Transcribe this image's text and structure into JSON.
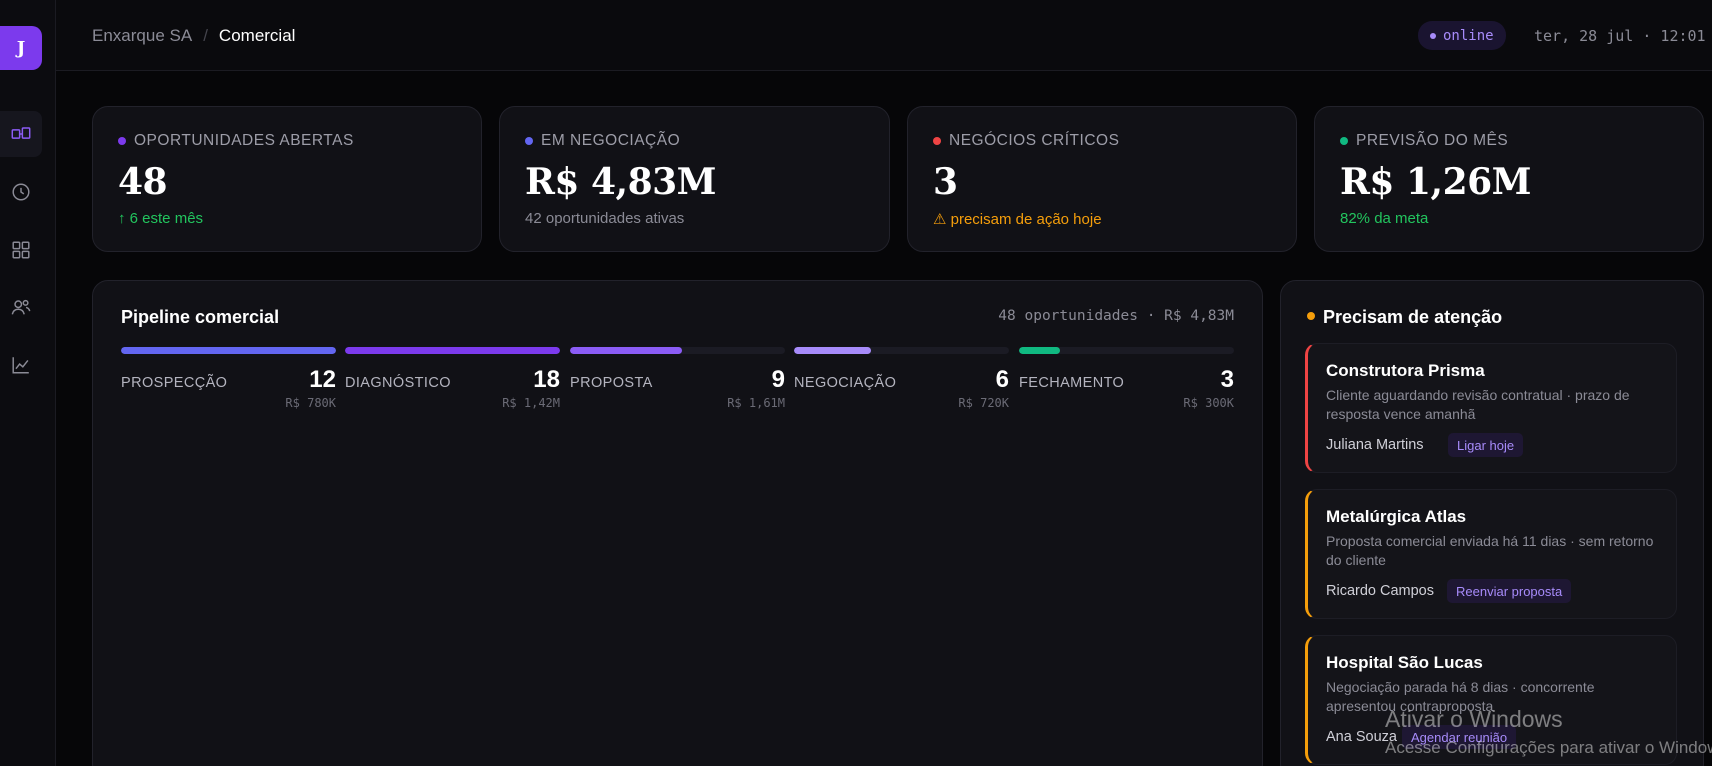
{
  "sidebar": {
    "avatar_initial": "J",
    "items": [
      {
        "icon": "pipeline-icon",
        "active": true
      },
      {
        "icon": "clock-icon",
        "active": false
      },
      {
        "icon": "grid-icon",
        "active": false
      },
      {
        "icon": "users-icon",
        "active": false
      },
      {
        "icon": "chart-icon",
        "active": false
      }
    ]
  },
  "header": {
    "breadcrumb": {
      "org": "Enxarque SA",
      "separator": "/",
      "current": "Comercial"
    },
    "status": "online",
    "datetime": "ter, 28 jul · 12:01"
  },
  "kpis": [
    {
      "label": "OPORTUNIDADES ABERTAS",
      "value": "48",
      "sub": "↑ 6 este mês",
      "dot_color": "#7c3aed",
      "sub_color": "#22c55e"
    },
    {
      "label": "EM NEGOCIAÇÃO",
      "value": "R$ 4,83M",
      "sub": "42 oportunidades ativas",
      "dot_color": "#6366f1",
      "sub_color": "#8b8b96"
    },
    {
      "label": "NEGÓCIOS CRÍTICOS",
      "value": "3",
      "sub": "⚠ precisam de ação hoje",
      "dot_color": "#ef4444",
      "sub_color": "#f59e0b"
    },
    {
      "label": "PREVISÃO DO MÊS",
      "value": "R$ 1,26M",
      "sub": "82% da meta",
      "dot_color": "#10b981",
      "sub_color": "#22c55e"
    }
  ],
  "pipeline": {
    "title": "Pipeline comercial",
    "meta": "48 oportunidades · R$ 4,83M",
    "stages": [
      {
        "name": "PROSPECÇÃO",
        "count": "12",
        "value": "R$ 780K",
        "progress": 1.0,
        "color": "#6366f1"
      },
      {
        "name": "DIAGNÓSTICO",
        "count": "18",
        "value": "R$ 1,42M",
        "progress": 1.0,
        "color": "#7c3aed"
      },
      {
        "name": "PROPOSTA",
        "count": "9",
        "value": "R$ 1,61M",
        "progress": 0.52,
        "color": "#8b5cf6"
      },
      {
        "name": "NEGOCIAÇÃO",
        "count": "6",
        "value": "R$ 720K",
        "progress": 0.36,
        "color": "#a78bfa"
      },
      {
        "name": "FECHAMENTO",
        "count": "3",
        "value": "R$ 300K",
        "progress": 0.19,
        "color": "#10b981"
      }
    ]
  },
  "attention": {
    "title": "Precisam de atenção",
    "cards": [
      {
        "title": "Construtora Prisma",
        "desc": "Cliente aguardando revisão contratual · prazo de resposta vence amanhã",
        "owner": "Juliana Martins",
        "action": "Ligar hoje",
        "border_color": "#ef4444"
      },
      {
        "title": "Metalúrgica Atlas",
        "desc": "Proposta comercial enviada há 11 dias · sem retorno do cliente",
        "owner": "Ricardo Campos",
        "action": "Reenviar proposta",
        "border_color": "#f59e0b"
      },
      {
        "title": "Hospital São Lucas",
        "desc": "Negociação parada há 8 dias · concorrente apresentou contraproposta",
        "owner": "Ana Souza",
        "action": "Agendar reunião",
        "border_color": "#f59e0b"
      }
    ]
  },
  "watermark": {
    "line1": "Ativar o Windows",
    "line2": "Acesse Configurações para ativar o Windows."
  }
}
